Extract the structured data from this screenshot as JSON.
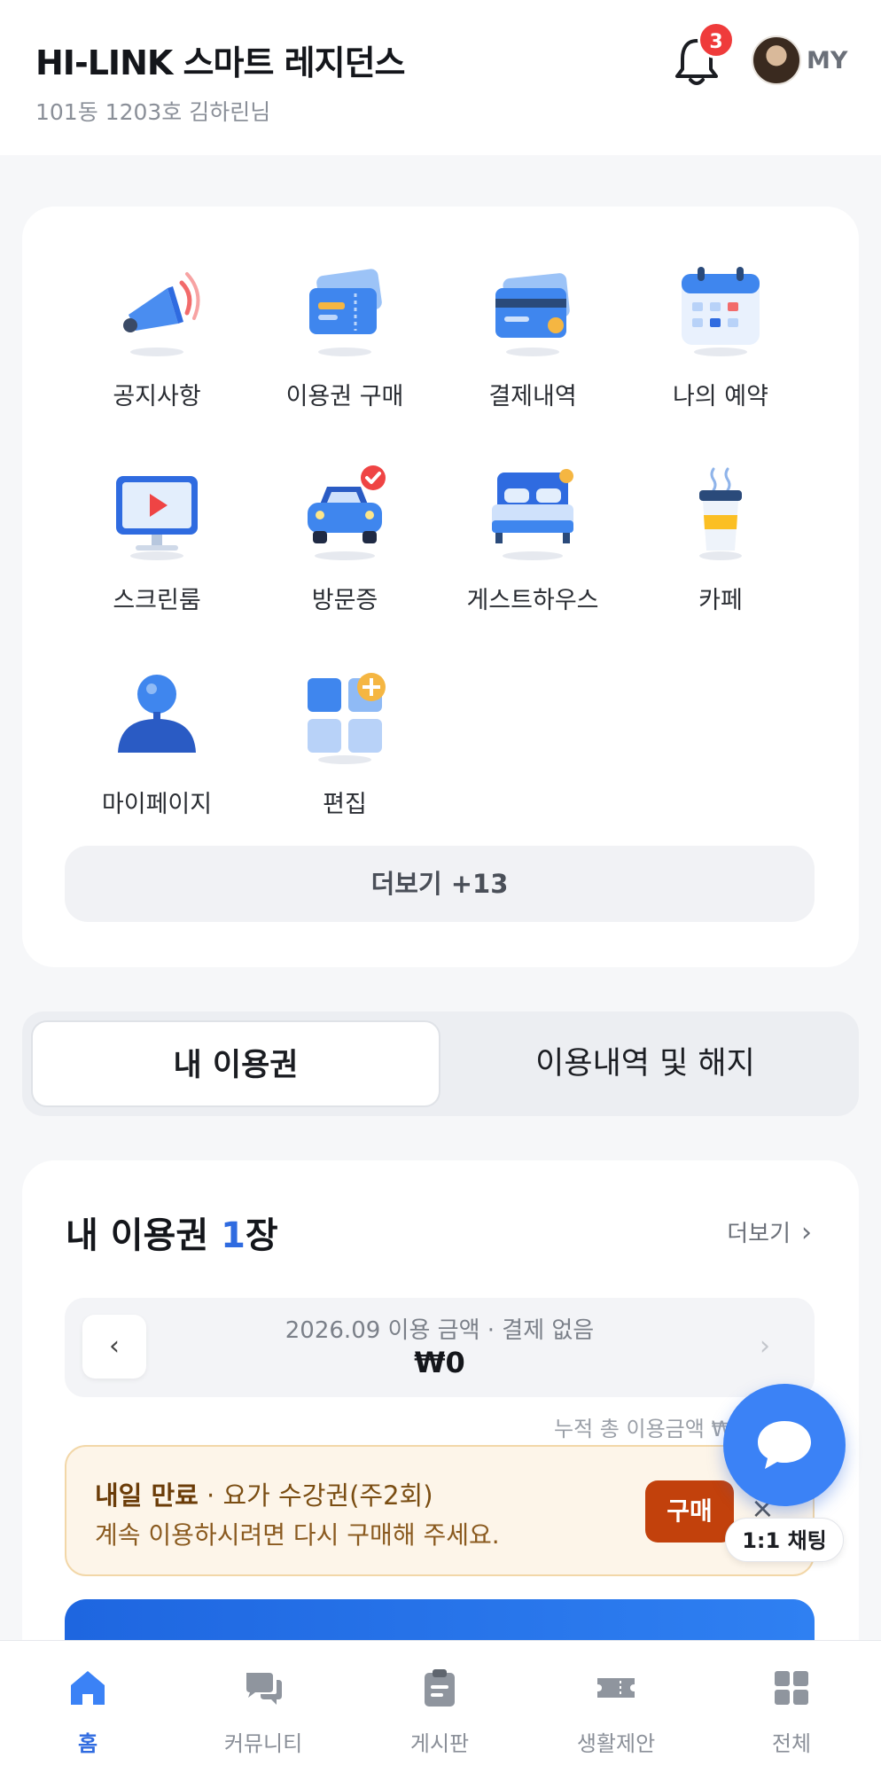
{
  "header": {
    "title": "HI-LINK 스마트 레지던스",
    "subtitle": "101동 1203호 김하린님",
    "notification_count": "3",
    "profile_label": "MY"
  },
  "menu": {
    "items": [
      {
        "label": "공지사항",
        "icon": "megaphone-icon"
      },
      {
        "label": "이용권 구매",
        "icon": "ticket-icon"
      },
      {
        "label": "결제내역",
        "icon": "credit-card-icon"
      },
      {
        "label": "나의 예약",
        "icon": "calendar-icon"
      },
      {
        "label": "스크린룸",
        "icon": "monitor-play-icon"
      },
      {
        "label": "방문증",
        "icon": "car-check-icon"
      },
      {
        "label": "게스트하우스",
        "icon": "bed-icon"
      },
      {
        "label": "카페",
        "icon": "coffee-cup-icon"
      },
      {
        "label": "마이페이지",
        "icon": "user-icon"
      },
      {
        "label": "편집",
        "icon": "grid-add-icon"
      }
    ],
    "more_label": "더보기 +13"
  },
  "tabs": {
    "tab1": "내 이용권",
    "tab2": "이용내역 및 해지"
  },
  "tickets": {
    "title_prefix": "내 이용권 ",
    "count": "1",
    "title_suffix": "장",
    "more_label": "더보기",
    "month_line": "2026.09 이용 금액 · 결제 없음",
    "month_amount": "₩0",
    "cumulative": "누적 총 이용금액 ₩",
    "expire_bold": "내일 만료",
    "expire_rest": " · 요가 수강권(주2회)",
    "expire_line2": "계속 이용하시려면 다시 구매해 주세요.",
    "buy_label": "구매",
    "close_label": "×"
  },
  "chat": {
    "label": "1:1 채팅"
  },
  "bottom_nav": {
    "items": [
      {
        "label": "홈",
        "icon": "home-icon"
      },
      {
        "label": "커뮤니티",
        "icon": "chat-bubbles-icon"
      },
      {
        "label": "게시판",
        "icon": "clipboard-icon"
      },
      {
        "label": "생활제안",
        "icon": "ticket-icon"
      },
      {
        "label": "전체",
        "icon": "grid-icon"
      }
    ]
  },
  "colors": {
    "accent": "#2f6be0",
    "badge": "#ef3b3b",
    "buy_button": "#c2410c",
    "chat_fab": "#3b82f6"
  }
}
